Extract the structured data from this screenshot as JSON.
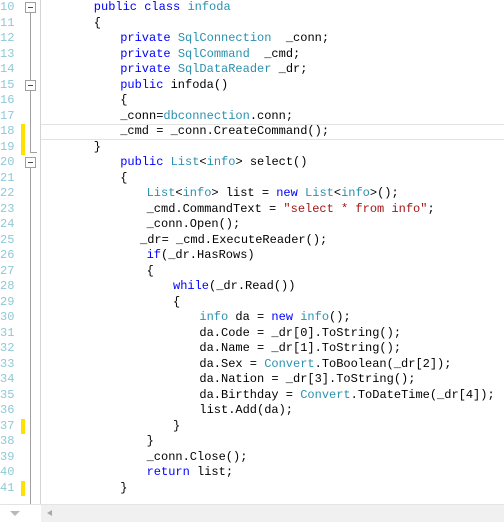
{
  "editor": {
    "app": "visual-studio-code-editor",
    "language": "csharp",
    "first_line_number": 10,
    "line_height": 15.5,
    "colors": {
      "keyword": "#0000ff",
      "type": "#2b91af",
      "string": "#a31515",
      "plain": "#000000",
      "line_number": "#8fc8d8",
      "change_bar_unsaved": "#ffe100",
      "change_bar_saved": "#e5d96a",
      "background": "#ffffff",
      "gutter_separator": "#d4d4d4",
      "outline": "#a0a0a0",
      "current_line_border": "#e2e2e2",
      "scrollbar": "#f0f0f0"
    },
    "current_line": 18,
    "change_marked_lines": [
      18,
      19,
      37,
      41
    ],
    "outline_boxes": [
      {
        "line": 10,
        "state": "expanded",
        "glyph": "minus-box"
      },
      {
        "line": 15,
        "state": "expanded",
        "glyph": "minus-box"
      },
      {
        "line": 20,
        "state": "expanded",
        "glyph": "minus-box"
      }
    ],
    "scrollbar": {
      "horizontal_visible": true,
      "left_arrow_icon": "arrow-left-icon",
      "corner_arrow_icon": "arrow-down-icon"
    },
    "lines": [
      {
        "n": 10,
        "indent": 8,
        "tokens": [
          {
            "t": "kw",
            "v": "public"
          },
          {
            "t": "pl",
            "v": " "
          },
          {
            "t": "kw",
            "v": "class"
          },
          {
            "t": "pl",
            "v": " "
          },
          {
            "t": "typ",
            "v": "infoda"
          }
        ]
      },
      {
        "n": 11,
        "indent": 8,
        "tokens": [
          {
            "t": "pl",
            "v": "{"
          }
        ]
      },
      {
        "n": 12,
        "indent": 12,
        "tokens": [
          {
            "t": "kw",
            "v": "private"
          },
          {
            "t": "pl",
            "v": " "
          },
          {
            "t": "typ",
            "v": "SqlConnection"
          },
          {
            "t": "pl",
            "v": "  _conn;"
          }
        ]
      },
      {
        "n": 13,
        "indent": 12,
        "tokens": [
          {
            "t": "kw",
            "v": "private"
          },
          {
            "t": "pl",
            "v": " "
          },
          {
            "t": "typ",
            "v": "SqlCommand"
          },
          {
            "t": "pl",
            "v": "  _cmd;"
          }
        ]
      },
      {
        "n": 14,
        "indent": 12,
        "tokens": [
          {
            "t": "kw",
            "v": "private"
          },
          {
            "t": "pl",
            "v": " "
          },
          {
            "t": "typ",
            "v": "SqlDataReader"
          },
          {
            "t": "pl",
            "v": " _dr;"
          }
        ]
      },
      {
        "n": 15,
        "indent": 12,
        "tokens": [
          {
            "t": "kw",
            "v": "public"
          },
          {
            "t": "pl",
            "v": " infoda()"
          }
        ]
      },
      {
        "n": 16,
        "indent": 12,
        "tokens": [
          {
            "t": "pl",
            "v": "{"
          }
        ]
      },
      {
        "n": 17,
        "indent": 12,
        "tokens": [
          {
            "t": "pl",
            "v": "_conn="
          },
          {
            "t": "typ",
            "v": "dbconnection"
          },
          {
            "t": "pl",
            "v": ".conn;"
          }
        ]
      },
      {
        "n": 18,
        "indent": 12,
        "tokens": [
          {
            "t": "pl",
            "v": "_cmd = _conn.CreateCommand();"
          }
        ]
      },
      {
        "n": 19,
        "indent": 8,
        "tokens": [
          {
            "t": "pl",
            "v": "}"
          }
        ]
      },
      {
        "n": 20,
        "indent": 12,
        "tokens": [
          {
            "t": "kw",
            "v": "public"
          },
          {
            "t": "pl",
            "v": " "
          },
          {
            "t": "typ",
            "v": "List"
          },
          {
            "t": "pl",
            "v": "<"
          },
          {
            "t": "typ",
            "v": "info"
          },
          {
            "t": "pl",
            "v": "> select()"
          }
        ]
      },
      {
        "n": 21,
        "indent": 12,
        "tokens": [
          {
            "t": "pl",
            "v": "{"
          }
        ]
      },
      {
        "n": 22,
        "indent": 16,
        "tokens": [
          {
            "t": "typ",
            "v": "List"
          },
          {
            "t": "pl",
            "v": "<"
          },
          {
            "t": "typ",
            "v": "info"
          },
          {
            "t": "pl",
            "v": "> list = "
          },
          {
            "t": "kw",
            "v": "new"
          },
          {
            "t": "pl",
            "v": " "
          },
          {
            "t": "typ",
            "v": "List"
          },
          {
            "t": "pl",
            "v": "<"
          },
          {
            "t": "typ",
            "v": "info"
          },
          {
            "t": "pl",
            "v": ">();"
          }
        ]
      },
      {
        "n": 23,
        "indent": 16,
        "tokens": [
          {
            "t": "pl",
            "v": "_cmd.CommandText = "
          },
          {
            "t": "str",
            "v": "\"select * from info\""
          },
          {
            "t": "pl",
            "v": ";"
          }
        ]
      },
      {
        "n": 24,
        "indent": 16,
        "tokens": [
          {
            "t": "pl",
            "v": "_conn.Open();"
          }
        ]
      },
      {
        "n": 25,
        "indent": 15,
        "tokens": [
          {
            "t": "pl",
            "v": "_dr= _cmd.ExecuteReader();"
          }
        ]
      },
      {
        "n": 26,
        "indent": 16,
        "tokens": [
          {
            "t": "kw",
            "v": "if"
          },
          {
            "t": "pl",
            "v": "(_dr.HasRows)"
          }
        ]
      },
      {
        "n": 27,
        "indent": 16,
        "tokens": [
          {
            "t": "pl",
            "v": "{"
          }
        ]
      },
      {
        "n": 28,
        "indent": 20,
        "tokens": [
          {
            "t": "kw",
            "v": "while"
          },
          {
            "t": "pl",
            "v": "(_dr.Read())"
          }
        ]
      },
      {
        "n": 29,
        "indent": 20,
        "tokens": [
          {
            "t": "pl",
            "v": "{"
          }
        ]
      },
      {
        "n": 30,
        "indent": 24,
        "tokens": [
          {
            "t": "typ",
            "v": "info"
          },
          {
            "t": "pl",
            "v": " da = "
          },
          {
            "t": "kw",
            "v": "new"
          },
          {
            "t": "pl",
            "v": " "
          },
          {
            "t": "typ",
            "v": "info"
          },
          {
            "t": "pl",
            "v": "();"
          }
        ]
      },
      {
        "n": 31,
        "indent": 24,
        "tokens": [
          {
            "t": "pl",
            "v": "da.Code = _dr[0].ToString();"
          }
        ]
      },
      {
        "n": 32,
        "indent": 24,
        "tokens": [
          {
            "t": "pl",
            "v": "da.Name = _dr[1].ToString();"
          }
        ]
      },
      {
        "n": 33,
        "indent": 24,
        "tokens": [
          {
            "t": "pl",
            "v": "da.Sex = "
          },
          {
            "t": "typ",
            "v": "Convert"
          },
          {
            "t": "pl",
            "v": ".ToBoolean(_dr[2]);"
          }
        ]
      },
      {
        "n": 34,
        "indent": 24,
        "tokens": [
          {
            "t": "pl",
            "v": "da.Nation = _dr[3].ToString();"
          }
        ]
      },
      {
        "n": 35,
        "indent": 24,
        "tokens": [
          {
            "t": "pl",
            "v": "da.Birthday = "
          },
          {
            "t": "typ",
            "v": "Convert"
          },
          {
            "t": "pl",
            "v": ".ToDateTime(_dr[4]);"
          }
        ]
      },
      {
        "n": 36,
        "indent": 24,
        "tokens": [
          {
            "t": "pl",
            "v": "list.Add(da);"
          }
        ]
      },
      {
        "n": 37,
        "indent": 20,
        "tokens": [
          {
            "t": "pl",
            "v": "}"
          }
        ]
      },
      {
        "n": 38,
        "indent": 16,
        "tokens": [
          {
            "t": "pl",
            "v": "}"
          }
        ]
      },
      {
        "n": 39,
        "indent": 16,
        "tokens": [
          {
            "t": "pl",
            "v": "_conn.Close();"
          }
        ]
      },
      {
        "n": 40,
        "indent": 16,
        "tokens": [
          {
            "t": "kw",
            "v": "return"
          },
          {
            "t": "pl",
            "v": " list;"
          }
        ]
      },
      {
        "n": 41,
        "indent": 12,
        "tokens": [
          {
            "t": "pl",
            "v": "}"
          }
        ]
      }
    ]
  }
}
